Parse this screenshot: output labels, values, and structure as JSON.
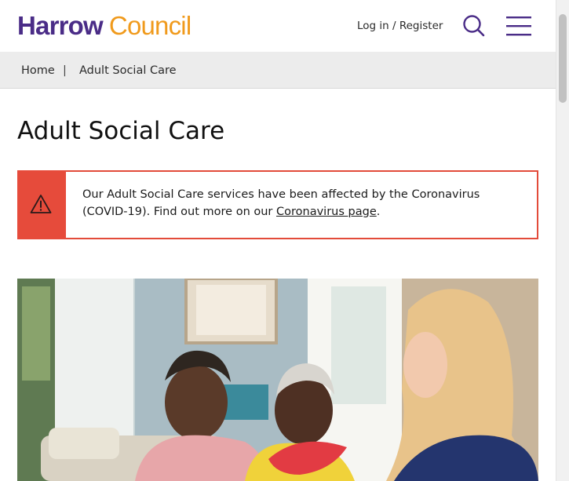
{
  "header": {
    "logo_word1": "Harrow",
    "logo_word2": "Council",
    "login_label": "Log in / Register",
    "search_icon": "search-icon",
    "menu_icon": "hamburger-menu-icon"
  },
  "breadcrumb": {
    "home": "Home",
    "separator": "|",
    "current": "Adult Social Care"
  },
  "main": {
    "title": "Adult Social Care",
    "alert": {
      "icon": "warning-triangle-icon",
      "text_before": "Our Adult Social Care services have been affected by the Coronavirus (COVID-19). Find out more on our ",
      "link_text": "Coronavirus page",
      "text_after": "."
    },
    "hero_image": "photo-carer-visiting-elderly-couple"
  },
  "colors": {
    "brand_purple": "#4a2c87",
    "brand_orange": "#f09a1c",
    "alert_red": "#e64b3b",
    "breadcrumb_bg": "#ececec"
  }
}
